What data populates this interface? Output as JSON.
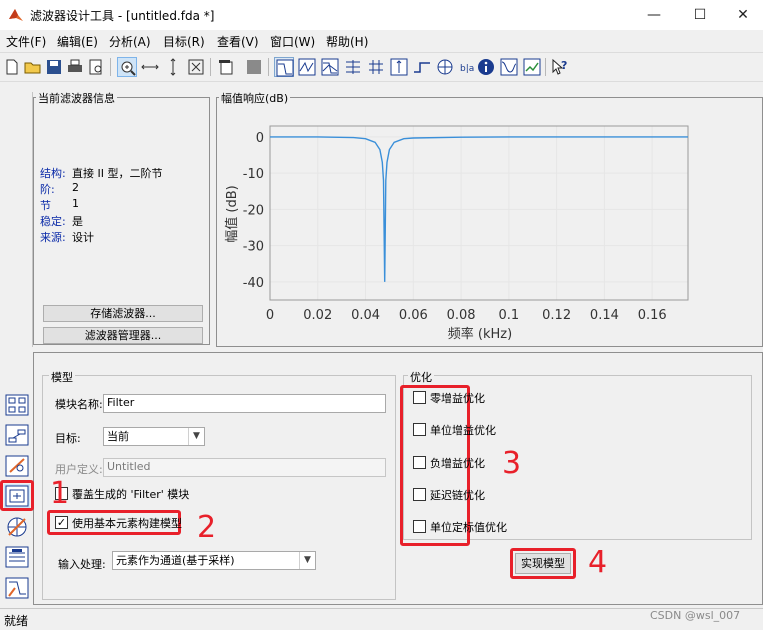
{
  "window": {
    "title": "滤波器设计工具 - [untitled.fda *]",
    "minimize": "—",
    "maximize": "☐",
    "close": "✕"
  },
  "menu": [
    "文件(F)",
    "编辑(E)",
    "分析(A)",
    "目标(R)",
    "查看(V)",
    "窗口(W)",
    "帮助(H)"
  ],
  "info_panel": {
    "title": "当前滤波器信息",
    "rows": [
      {
        "label": "结构:",
        "value": "直接 II 型，二阶节"
      },
      {
        "label": "阶:",
        "value": "2"
      },
      {
        "label": "节",
        "value": "1"
      },
      {
        "label": "稳定:",
        "value": "是"
      },
      {
        "label": "来源:",
        "value": "设计"
      }
    ],
    "store_button": "存储滤波器...",
    "manager_button": "滤波器管理器..."
  },
  "response_panel": {
    "title": "幅值响应(dB)"
  },
  "chart_data": {
    "type": "line",
    "title": "",
    "xlabel": "频率 (kHz)",
    "ylabel": "幅值 (dB)",
    "xlim": [
      0,
      0.175
    ],
    "ylim": [
      -45,
      3
    ],
    "xticks": [
      "0",
      "0.02",
      "0.04",
      "0.06",
      "0.08",
      "0.1",
      "0.12",
      "0.14",
      "0.16"
    ],
    "yticks": [
      "0",
      "-10",
      "-20",
      "-30",
      "-40"
    ],
    "line_color": "#3a8fd9",
    "series": [
      {
        "x": [
          0,
          0.02,
          0.035,
          0.04,
          0.044,
          0.046,
          0.047,
          0.0475,
          0.048,
          0.0485,
          0.049,
          0.05,
          0.052,
          0.056,
          0.06,
          0.08,
          0.1,
          0.12,
          0.14,
          0.16,
          0.175
        ],
        "values": [
          0,
          0,
          -0.2,
          -0.5,
          -1.5,
          -3.5,
          -7,
          -12,
          -40,
          -12,
          -7,
          -3.5,
          -1.5,
          -0.5,
          -0.3,
          -0.1,
          0,
          0,
          0,
          0,
          0
        ]
      }
    ]
  },
  "model_panel": {
    "title": "模型",
    "block_name_label": "模块名称:",
    "block_name_value": "Filter",
    "target_label": "目标:",
    "target_value": "当前",
    "user_defined_label": "用户定义:",
    "user_defined_value": "Untitled",
    "overwrite_label": "覆盖生成的 'Filter' 模块",
    "use_basic_label": "使用基本元素构建模型",
    "use_basic_checked": "✓",
    "input_processing_label": "输入处理:",
    "input_processing_value": "元素作为通道(基于采样)"
  },
  "optimize_panel": {
    "title": "优化",
    "options": [
      "零增益优化",
      "单位增益优化",
      "负增益优化",
      "延迟链优化",
      "单位定标值优化"
    ]
  },
  "realize_button": "实现模型",
  "annotations": [
    "1",
    "2",
    "3",
    "4"
  ],
  "status": "就绪",
  "watermark": "CSDN @wsl_007"
}
